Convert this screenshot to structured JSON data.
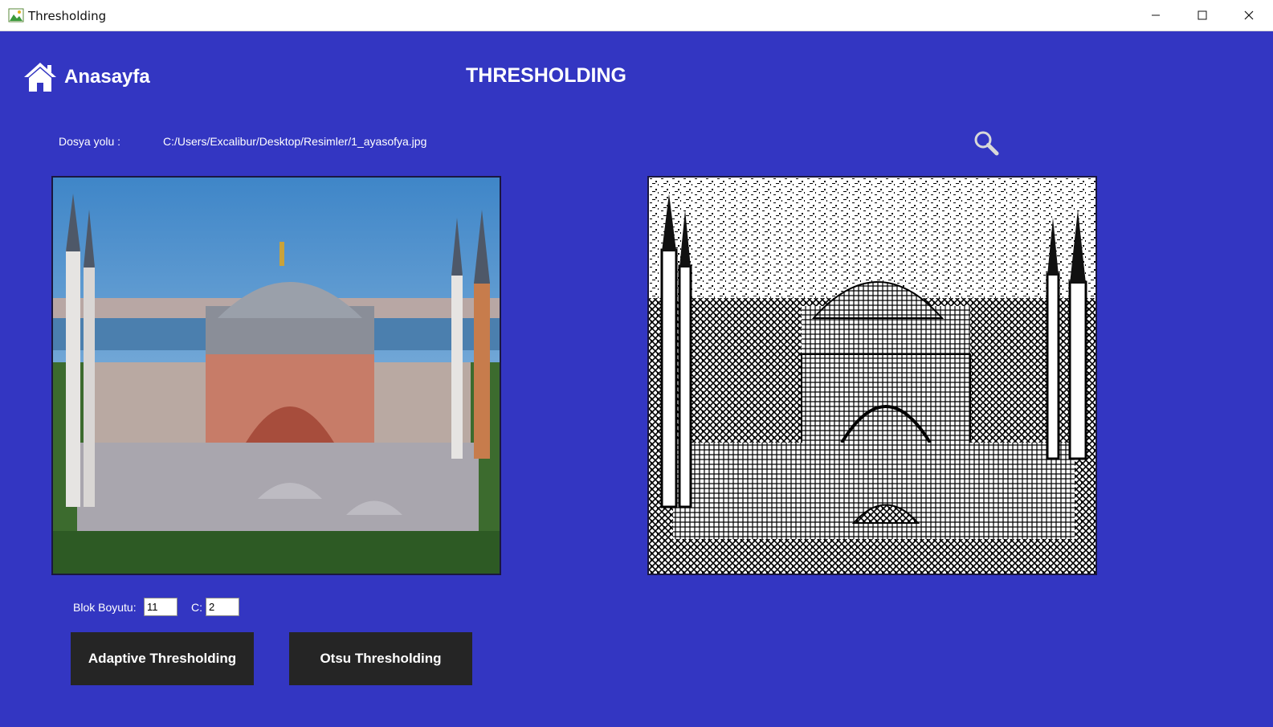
{
  "window": {
    "title": "Thresholding",
    "icons": {
      "app": "image-icon",
      "minimize": "minimize-icon",
      "maximize": "maximize-icon",
      "close": "close-icon"
    }
  },
  "header": {
    "home_label": "Anasayfa",
    "home_icon": "home-icon",
    "page_title": "THRESHOLDING"
  },
  "file": {
    "path_label": "Dosya yolu :",
    "path_value": "C:/Users/Excalibur/Desktop/Resimler/1_ayasofya.jpg",
    "browse_icon": "search-icon"
  },
  "images": {
    "original": "photo of Hagia Sophia (original)",
    "result": "thresholded black-and-white result"
  },
  "params": {
    "block_label": "Blok Boyutu:",
    "block_value": "11",
    "c_label": "C:",
    "c_value": "2"
  },
  "buttons": {
    "adaptive": "Adaptive Thresholding",
    "otsu": "Otsu Thresholding"
  },
  "colors": {
    "background": "#3336c2",
    "button": "#252525",
    "text": "#ffffff"
  }
}
